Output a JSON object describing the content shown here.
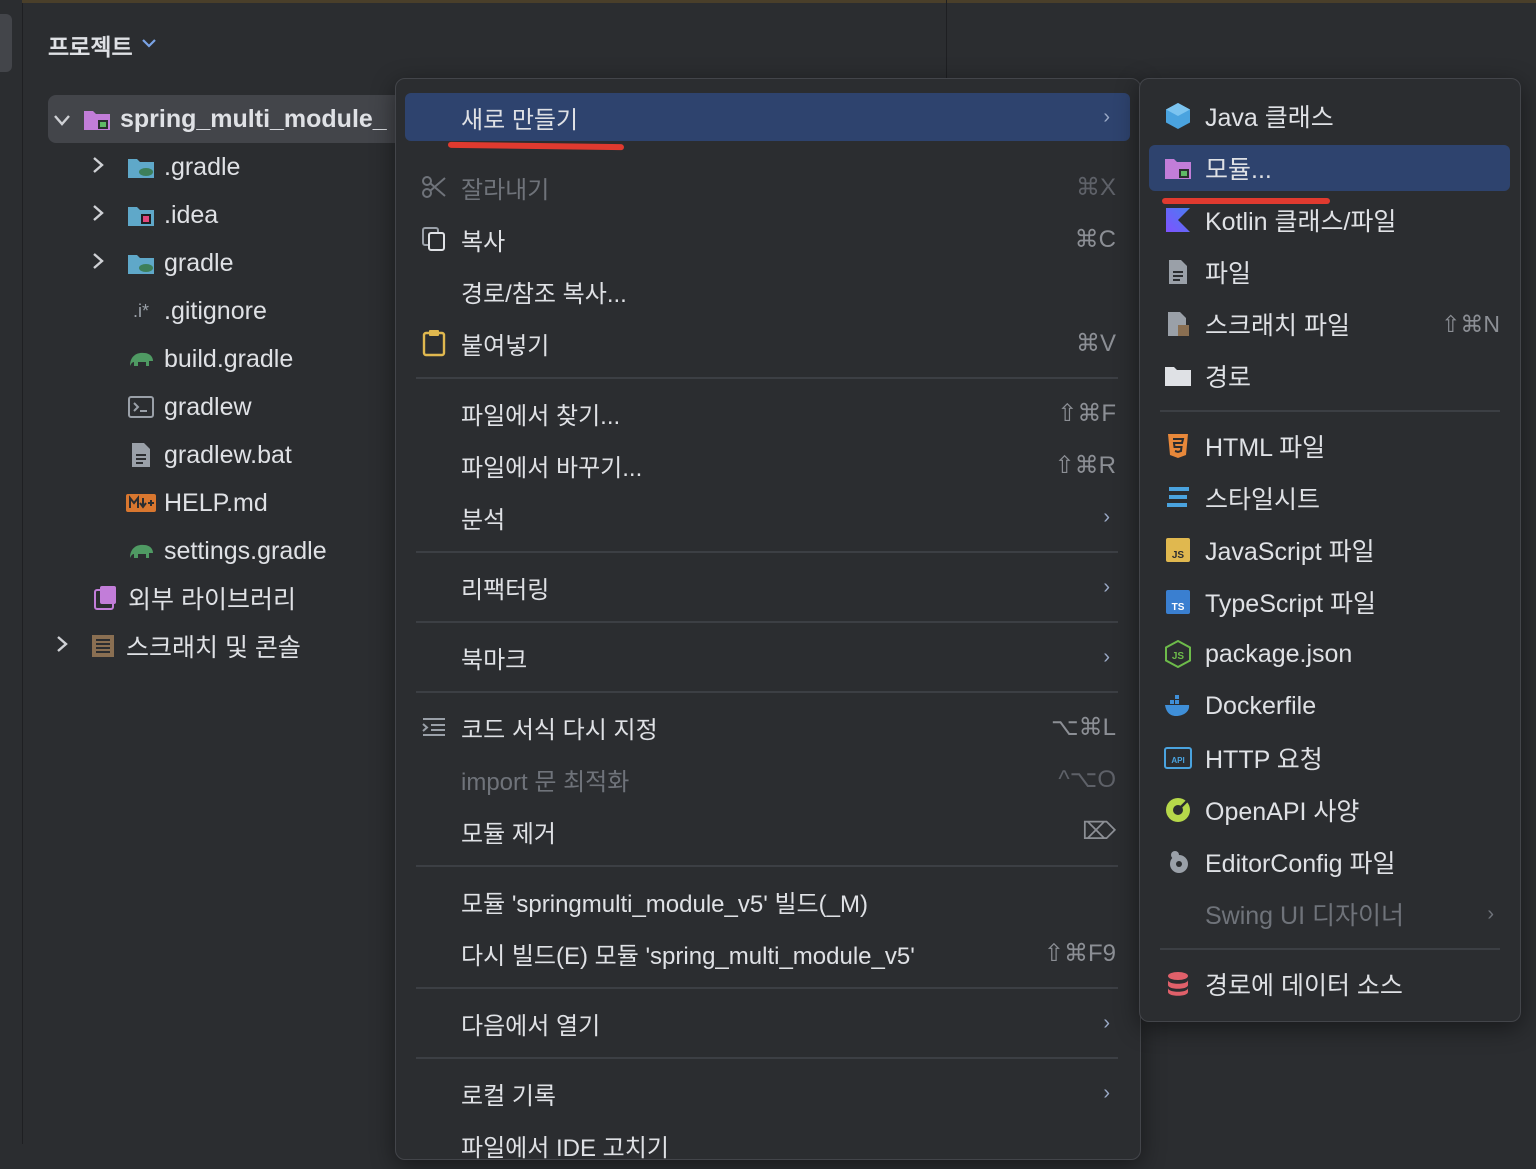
{
  "panel": {
    "title": "프로젝트"
  },
  "tree": [
    {
      "label": "spring_multi_module_",
      "expanded": true
    },
    {
      "label": ".gradle"
    },
    {
      "label": ".idea"
    },
    {
      "label": "gradle"
    },
    {
      "label": ".gitignore"
    },
    {
      "label": "build.gradle"
    },
    {
      "label": "gradlew"
    },
    {
      "label": "gradlew.bat"
    },
    {
      "label": "HELP.md"
    },
    {
      "label": "settings.gradle"
    },
    {
      "label": "외부 라이브러리"
    },
    {
      "label": "스크래치 및 콘솔"
    }
  ],
  "context_menu": [
    {
      "label": "새로 만들기",
      "submenu": true,
      "highlighted": true
    },
    {
      "label": "잘라내기",
      "shortcut": "⌘X",
      "icon": "scissors-icon",
      "disabled": true
    },
    {
      "label": "복사",
      "shortcut": "⌘C",
      "icon": "copy-icon"
    },
    {
      "label": "경로/참조 복사..."
    },
    {
      "label": "붙여넣기",
      "shortcut": "⌘V",
      "icon": "clipboard-icon"
    },
    {
      "label": "파일에서 찾기...",
      "shortcut": "⇧⌘F"
    },
    {
      "label": "파일에서 바꾸기...",
      "shortcut": "⇧⌘R"
    },
    {
      "label": "분석",
      "submenu": true
    },
    {
      "label": "리팩터링",
      "submenu": true
    },
    {
      "label": "북마크",
      "submenu": true
    },
    {
      "label": "코드 서식 다시 지정",
      "shortcut": "⌥⌘L",
      "icon": "reformat-icon"
    },
    {
      "label": "import 문 최적화",
      "shortcut": "^⌥O",
      "disabled": true
    },
    {
      "label": "모듈 제거",
      "shortcut": "⌦"
    },
    {
      "label": "모듈 'springmulti_module_v5' 빌드(_M)"
    },
    {
      "label": "다시 빌드(E) 모듈 'spring_multi_module_v5'",
      "shortcut": "⇧⌘F9"
    },
    {
      "label": "다음에서 열기",
      "submenu": true
    },
    {
      "label": "로컬 기록",
      "submenu": true
    },
    {
      "label": "파일에서 IDE 고치기"
    }
  ],
  "submenu": [
    {
      "label": "Java 클래스",
      "icon": "java-class-icon"
    },
    {
      "label": "모듈...",
      "icon": "module-icon",
      "highlighted": true
    },
    {
      "label": "Kotlin 클래스/파일",
      "icon": "kotlin-icon"
    },
    {
      "label": "파일",
      "icon": "file-icon"
    },
    {
      "label": "스크래치 파일",
      "icon": "scratch-file-icon",
      "shortcut": "⇧⌘N"
    },
    {
      "label": "경로",
      "icon": "folder-icon"
    },
    {
      "label": "HTML 파일",
      "icon": "html-icon"
    },
    {
      "label": "스타일시트",
      "icon": "css-icon"
    },
    {
      "label": "JavaScript 파일",
      "icon": "javascript-icon"
    },
    {
      "label": "TypeScript 파일",
      "icon": "typescript-icon"
    },
    {
      "label": "package.json",
      "icon": "nodejs-icon"
    },
    {
      "label": "Dockerfile",
      "icon": "docker-icon"
    },
    {
      "label": "HTTP 요청",
      "icon": "api-icon"
    },
    {
      "label": "OpenAPI 사양",
      "icon": "openapi-icon"
    },
    {
      "label": "EditorConfig 파일",
      "icon": "editorconfig-icon"
    },
    {
      "label": "Swing UI 디자이너",
      "disabled": true,
      "submenu": true
    },
    {
      "label": "경로에 데이터 소스",
      "icon": "database-icon"
    }
  ],
  "colors": {
    "background": "#2b2d30",
    "highlight": "#2e436e",
    "annotation": "#e03a2f"
  }
}
